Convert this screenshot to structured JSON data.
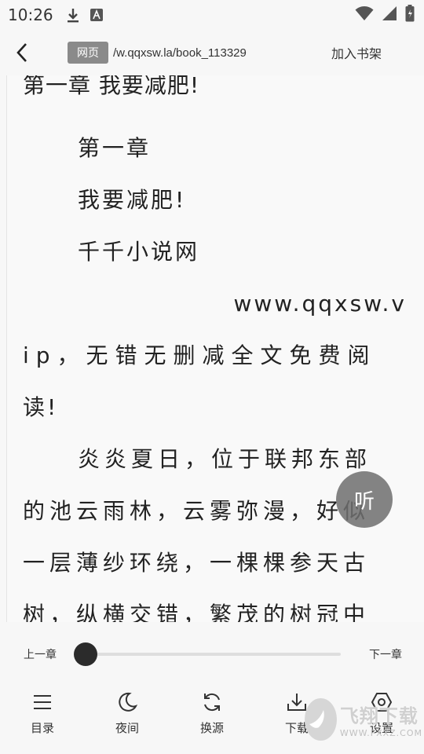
{
  "status_bar": {
    "time": "10:26"
  },
  "header": {
    "badge": "网页",
    "url": "/w.qqxsw.la/book_113329",
    "add_to_shelf": "加入书架"
  },
  "reader": {
    "chapter_heading": "第一章 我要减肥!",
    "lines": {
      "l1": "第一章",
      "l2": "我要减肥!",
      "l3": "千千小说网",
      "l4": "www.qqxsw.v",
      "l5": "ip，无错无删减全文免费阅",
      "l6": "读!",
      "l7": "炎炎夏日，位于联邦东部",
      "l8": "的池云雨林，云雾弥漫，好似",
      "l9": "一层薄纱环绕，一棵棵参天古",
      "l10": "树，纵横交错，繁茂的树冠中"
    }
  },
  "listen_button": "听",
  "progress": {
    "prev_chapter": "上一章",
    "next_chapter": "下一章",
    "value": 0.0
  },
  "toolbar": {
    "items": [
      {
        "label": "目录",
        "icon": "menu-icon"
      },
      {
        "label": "夜间",
        "icon": "moon-icon"
      },
      {
        "label": "换源",
        "icon": "refresh-icon"
      },
      {
        "label": "下载",
        "icon": "download-icon"
      },
      {
        "label": "设置",
        "icon": "settings-icon"
      }
    ]
  },
  "watermark": {
    "title": "飞翔下载",
    "url": "WWW.FXXZ.COM"
  }
}
